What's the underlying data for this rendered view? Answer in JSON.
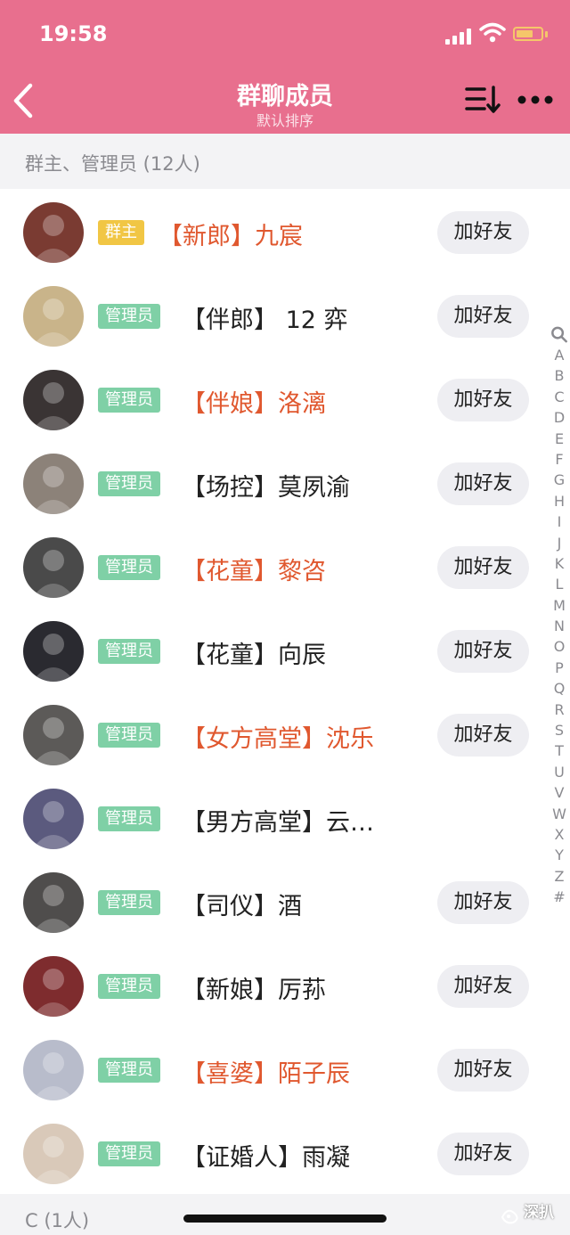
{
  "status_bar": {
    "time": "19:58"
  },
  "nav": {
    "title": "群聊成员",
    "subtitle": "默认排序",
    "back_icon": "chevron-left-icon",
    "sort_icon": "sort-icon",
    "more_icon": "more-horizontal-icon"
  },
  "sections": [
    {
      "title": "群主、管理员 (12人)"
    },
    {
      "title": "C (1人)"
    }
  ],
  "members": [
    {
      "badge": "群主",
      "badge_type": "owner",
      "name": "【新郎】九宸",
      "highlight": true,
      "action": "加好友",
      "avatar_color": "#7a3b32"
    },
    {
      "badge": "管理员",
      "badge_type": "admin",
      "name": "【伴郎】 12 弈",
      "highlight": false,
      "action": "加好友",
      "avatar_color": "#c9b48a"
    },
    {
      "badge": "管理员",
      "badge_type": "admin",
      "name": "【伴娘】洛漓",
      "highlight": true,
      "action": "加好友",
      "avatar_color": "#3a3434"
    },
    {
      "badge": "管理员",
      "badge_type": "admin",
      "name": "【场控】莫夙渝",
      "highlight": false,
      "action": "加好友",
      "avatar_color": "#8c8279"
    },
    {
      "badge": "管理员",
      "badge_type": "admin",
      "name": "【花童】黎咨",
      "highlight": true,
      "action": "加好友",
      "avatar_color": "#4a4a4a"
    },
    {
      "badge": "管理员",
      "badge_type": "admin",
      "name": "【花童】向辰",
      "highlight": false,
      "action": "加好友",
      "avatar_color": "#2a2a30"
    },
    {
      "badge": "管理员",
      "badge_type": "admin",
      "name": "【女方高堂】沈乐",
      "highlight": true,
      "action": "加好友",
      "avatar_color": "#5c5a58"
    },
    {
      "badge": "管理员",
      "badge_type": "admin",
      "name": "【男方高堂】云…",
      "highlight": false,
      "action": "",
      "avatar_color": "#5b5a7e"
    },
    {
      "badge": "管理员",
      "badge_type": "admin",
      "name": "【司仪】酒",
      "highlight": false,
      "action": "加好友",
      "avatar_color": "#4f4d4c"
    },
    {
      "badge": "管理员",
      "badge_type": "admin",
      "name": "【新娘】厉荪",
      "highlight": false,
      "action": "加好友",
      "avatar_color": "#7e2c2e"
    },
    {
      "badge": "管理员",
      "badge_type": "admin",
      "name": "【喜婆】陌子辰",
      "highlight": true,
      "action": "加好友",
      "avatar_color": "#b8bccb"
    },
    {
      "badge": "管理员",
      "badge_type": "admin",
      "name": "【证婚人】雨凝",
      "highlight": false,
      "action": "加好友",
      "avatar_color": "#d9c9b9"
    }
  ],
  "alphabet_index": [
    "A",
    "B",
    "C",
    "D",
    "E",
    "F",
    "G",
    "H",
    "I",
    "J",
    "K",
    "L",
    "M",
    "N",
    "O",
    "P",
    "Q",
    "R",
    "S",
    "T",
    "U",
    "V",
    "W",
    "X",
    "Y",
    "Z",
    "#"
  ],
  "watermark": {
    "text": "深扒",
    "sub": "深扒"
  },
  "colors": {
    "header_bg": "#e86f8e",
    "owner_badge": "#f1c644",
    "admin_badge": "#7fd0a6",
    "highlight_name": "#e0582f",
    "button_bg": "#eeeef2"
  }
}
